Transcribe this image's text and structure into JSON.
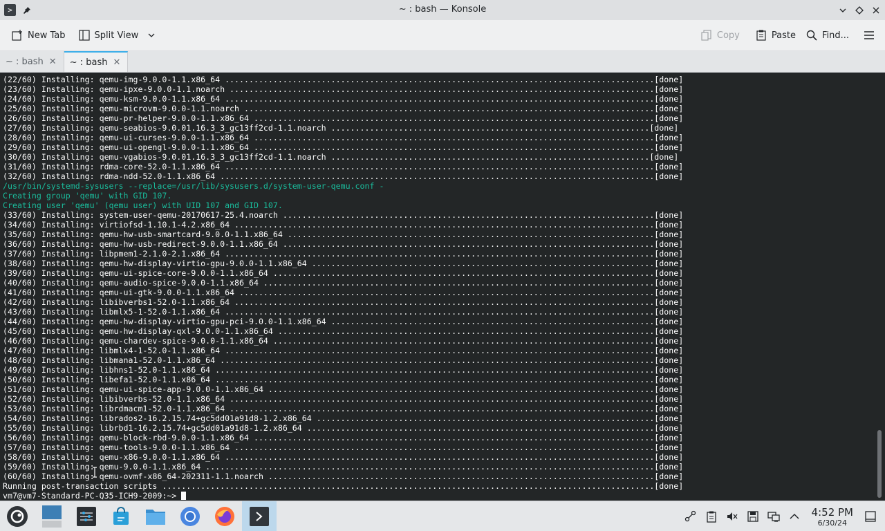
{
  "window": {
    "title": "~ : bash — Konsole"
  },
  "toolbar": {
    "new_tab": "New Tab",
    "split_view": "Split View",
    "copy": "Copy",
    "paste": "Paste",
    "find": "Find..."
  },
  "tabs": [
    {
      "label": "~ : bash",
      "active": false
    },
    {
      "label": "~ : bash",
      "active": true
    }
  ],
  "terminal": {
    "lines": [
      {
        "text": "(22/60) Installing: qemu-img-9.0.0-1.1.x86_64 .........................................................................................[done]",
        "style": "normal"
      },
      {
        "text": "(23/60) Installing: qemu-ipxe-9.0.0-1.1.noarch ........................................................................................[done]",
        "style": "normal"
      },
      {
        "text": "(24/60) Installing: qemu-ksm-9.0.0-1.1.x86_64 .........................................................................................[done]",
        "style": "normal"
      },
      {
        "text": "(25/60) Installing: qemu-microvm-9.0.0-1.1.noarch .....................................................................................[done]",
        "style": "normal"
      },
      {
        "text": "(26/60) Installing: qemu-pr-helper-9.0.0-1.1.x86_64 ...................................................................................[done]",
        "style": "normal"
      },
      {
        "text": "(27/60) Installing: qemu-seabios-9.0.01.16.3_3_gc13ff2cd-1.1.noarch ..................................................................[done]",
        "style": "normal"
      },
      {
        "text": "(28/60) Installing: qemu-ui-curses-9.0.0-1.1.x86_64 ...................................................................................[done]",
        "style": "normal"
      },
      {
        "text": "(29/60) Installing: qemu-ui-opengl-9.0.0-1.1.x86_64 ...................................................................................[done]",
        "style": "normal"
      },
      {
        "text": "(30/60) Installing: qemu-vgabios-9.0.01.16.3_3_gc13ff2cd-1.1.noarch ..................................................................[done]",
        "style": "normal"
      },
      {
        "text": "(31/60) Installing: rdma-core-52.0-1.1.x86_64 .........................................................................................[done]",
        "style": "normal"
      },
      {
        "text": "(32/60) Installing: rdma-ndd-52.0-1.1.x86_64 ..........................................................................................[done]",
        "style": "normal"
      },
      {
        "text": "/usr/bin/systemd-sysusers --replace=/usr/lib/sysusers.d/system-user-qemu.conf -",
        "style": "teal"
      },
      {
        "text": "Creating group 'qemu' with GID 107.",
        "style": "teal"
      },
      {
        "text": "Creating user 'qemu' (qemu user) with UID 107 and GID 107.",
        "style": "teal"
      },
      {
        "text": "(33/60) Installing: system-user-qemu-20170617-25.4.noarch .............................................................................[done]",
        "style": "normal"
      },
      {
        "text": "(34/60) Installing: virtiofsd-1.10.1-4.2.x86_64 .......................................................................................[done]",
        "style": "normal"
      },
      {
        "text": "(35/60) Installing: qemu-hw-usb-smartcard-9.0.0-1.1.x86_64 ............................................................................[done]",
        "style": "normal"
      },
      {
        "text": "(36/60) Installing: qemu-hw-usb-redirect-9.0.0-1.1.x86_64 .............................................................................[done]",
        "style": "normal"
      },
      {
        "text": "(37/60) Installing: libpmem1-2.1.0-2.1.x86_64 .........................................................................................[done]",
        "style": "normal"
      },
      {
        "text": "(38/60) Installing: qemu-hw-display-virtio-gpu-9.0.0-1.1.x86_64 .......................................................................[done]",
        "style": "normal"
      },
      {
        "text": "(39/60) Installing: qemu-ui-spice-core-9.0.0-1.1.x86_64 ...............................................................................[done]",
        "style": "normal"
      },
      {
        "text": "(40/60) Installing: qemu-audio-spice-9.0.0-1.1.x86_64 .................................................................................[done]",
        "style": "normal"
      },
      {
        "text": "(41/60) Installing: qemu-ui-gtk-9.0.0-1.1.x86_64 ......................................................................................[done]",
        "style": "normal"
      },
      {
        "text": "(42/60) Installing: libibverbs1-52.0-1.1.x86_64 .......................................................................................[done]",
        "style": "normal"
      },
      {
        "text": "(43/60) Installing: libmlx5-1-52.0-1.1.x86_64 .........................................................................................[done]",
        "style": "normal"
      },
      {
        "text": "(44/60) Installing: qemu-hw-display-virtio-gpu-pci-9.0.0-1.1.x86_64 ...................................................................[done]",
        "style": "normal"
      },
      {
        "text": "(45/60) Installing: qemu-hw-display-qxl-9.0.0-1.1.x86_64 ..............................................................................[done]",
        "style": "normal"
      },
      {
        "text": "(46/60) Installing: qemu-chardev-spice-9.0.0-1.1.x86_64 ...............................................................................[done]",
        "style": "normal"
      },
      {
        "text": "(47/60) Installing: libmlx4-1-52.0-1.1.x86_64 .........................................................................................[done]",
        "style": "normal"
      },
      {
        "text": "(48/60) Installing: libmana1-52.0-1.1.x86_64 ..........................................................................................[done]",
        "style": "normal"
      },
      {
        "text": "(49/60) Installing: libhns1-52.0-1.1.x86_64 ...........................................................................................[done]",
        "style": "normal"
      },
      {
        "text": "(50/60) Installing: libefa1-52.0-1.1.x86_64 ...........................................................................................[done]",
        "style": "normal"
      },
      {
        "text": "(51/60) Installing: qemu-ui-spice-app-9.0.0-1.1.x86_64 ................................................................................[done]",
        "style": "normal"
      },
      {
        "text": "(52/60) Installing: libibverbs-52.0-1.1.x86_64 ........................................................................................[done]",
        "style": "normal"
      },
      {
        "text": "(53/60) Installing: librdmacm1-52.0-1.1.x86_64 ........................................................................................[done]",
        "style": "normal"
      },
      {
        "text": "(54/60) Installing: librados2-16.2.15.74+gc5dd01a91d8-1.2.x86_64 ......................................................................[done]",
        "style": "normal"
      },
      {
        "text": "(55/60) Installing: librbd1-16.2.15.74+gc5dd01a91d8-1.2.x86_64 ........................................................................[done]",
        "style": "normal"
      },
      {
        "text": "(56/60) Installing: qemu-block-rbd-9.0.0-1.1.x86_64 ...................................................................................[done]",
        "style": "normal"
      },
      {
        "text": "(57/60) Installing: qemu-tools-9.0.0-1.1.x86_64 .......................................................................................[done]",
        "style": "normal"
      },
      {
        "text": "(58/60) Installing: qemu-x86-9.0.0-1.1.x86_64 .........................................................................................[done]",
        "style": "normal"
      },
      {
        "text": "(59/60) Installing: qemu-9.0.0-1.1.x86_64 .............................................................................................[done]",
        "style": "normal"
      },
      {
        "text": "(60/60) Installing: qemu-ovmf-x86_64-202311-1.1.noarch ................................................................................[done]",
        "style": "normal"
      },
      {
        "text": "Running post-transaction scripts ......................................................................................................[done]",
        "style": "normal"
      }
    ],
    "prompt": "vm7@vm7-Standard-PC-Q35-ICH9-2009:~> "
  },
  "taskbar": {
    "clock_time": "4:52 PM",
    "clock_date": "6/30/24"
  },
  "colors": {
    "terminal_bg": "#232627",
    "terminal_fg": "#fcfcfc",
    "terminal_teal": "#1abc9c",
    "accent": "#3daee9"
  }
}
